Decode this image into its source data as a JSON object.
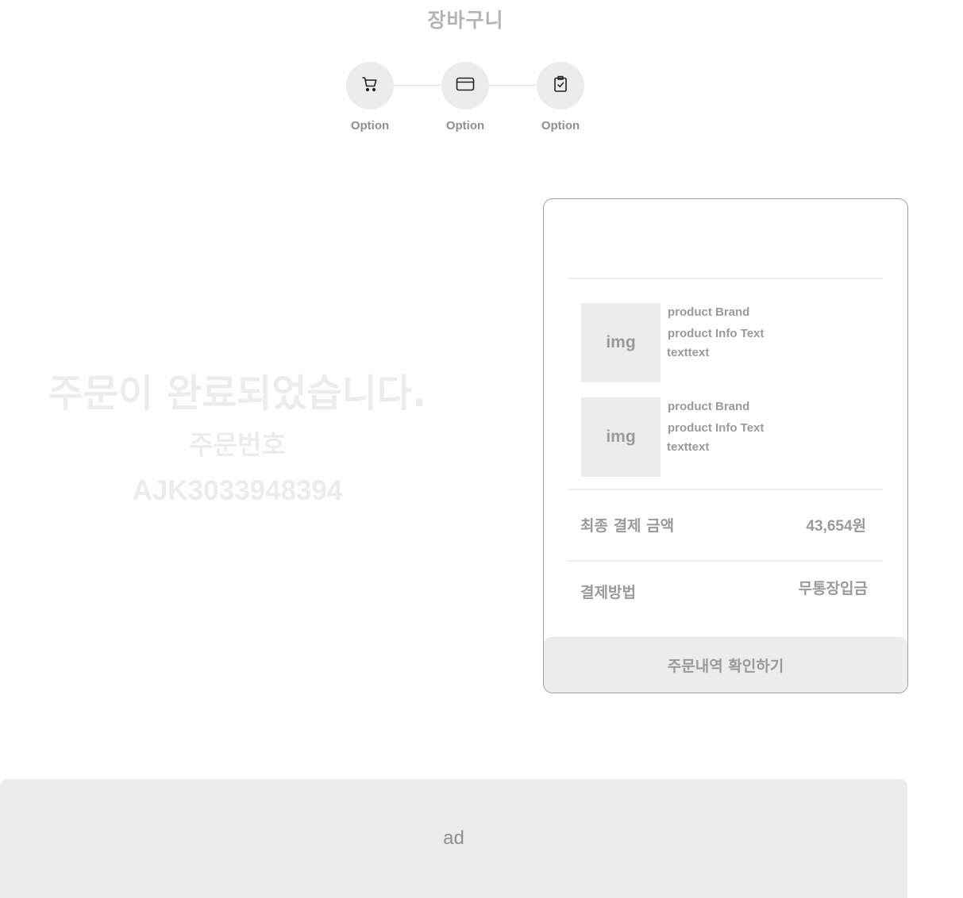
{
  "header": {
    "title": "장바구니"
  },
  "steps": [
    {
      "icon": "cart-icon",
      "label": "Option"
    },
    {
      "icon": "credit-card-icon",
      "label": "Option"
    },
    {
      "icon": "clipboard-check-icon",
      "label": "Option"
    }
  ],
  "completion": {
    "message": "주문이 완료되었습니다.",
    "order_number_label": "주문번호",
    "order_number": "AJK3033948394"
  },
  "order_card": {
    "products": [
      {
        "image_text": "img",
        "brand": "product Brand",
        "info": "product Info Text",
        "info_extra": "texttext"
      },
      {
        "image_text": "img",
        "brand": "product Brand",
        "info": "product Info Text",
        "info_extra": "texttext"
      }
    ],
    "total_label": "최종 결제 금액",
    "total_value": "43,654원",
    "payment_label": "결제방법",
    "payment_value": "무통장입금",
    "confirm_button": "주문내역 확인하기"
  },
  "ad": {
    "label": "ad"
  }
}
